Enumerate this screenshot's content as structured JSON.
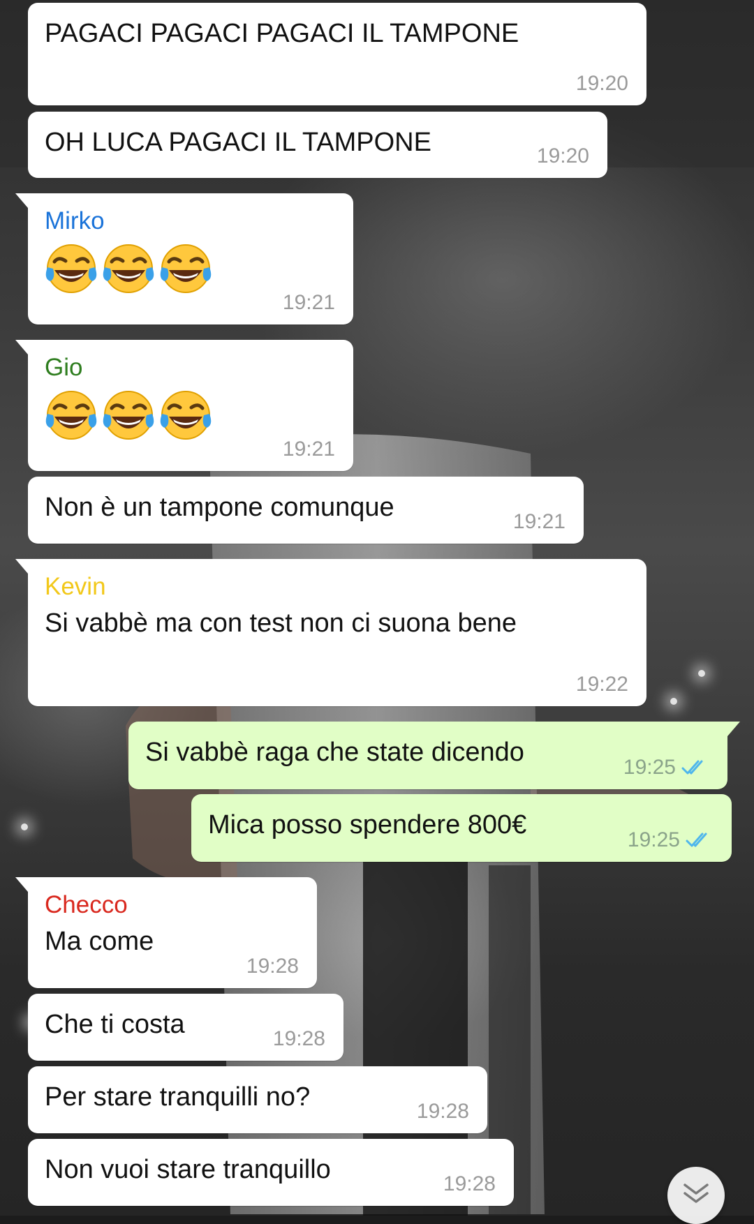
{
  "theme": {
    "outgoing_bubble_color": "#e1fec6",
    "incoming_bubble_color": "#ffffff",
    "read_check_color": "#4fb6ec"
  },
  "messages": [
    {
      "text": "PAGACI PAGACI PAGACI IL TAMPONE",
      "time": "19:20"
    },
    {
      "text": "OH LUCA PAGACI IL TAMPONE",
      "time": "19:20"
    },
    {
      "sender": "Mirko",
      "sender_color": "#1a73d9",
      "emoji": "face-with-tears-of-joy-x3",
      "time": "19:21"
    },
    {
      "sender": "Gio",
      "sender_color": "#2e7d1e",
      "emoji": "face-with-tears-of-joy-x3",
      "time": "19:21"
    },
    {
      "text": "Non è un tampone comunque",
      "time": "19:21"
    },
    {
      "sender": "Kevin",
      "sender_color": "#f2c81a",
      "text": "Si vabbè ma con test non ci suona bene",
      "time": "19:22"
    },
    {
      "text": "Si vabbè raga che state dicendo",
      "time": "19:25",
      "outgoing": true,
      "status": "read"
    },
    {
      "text": "Mica posso spendere 800€",
      "time": "19:25",
      "outgoing": true,
      "status": "read"
    },
    {
      "sender": "Checco",
      "sender_color": "#d9281e",
      "text": "Ma come",
      "time": "19:28"
    },
    {
      "text": "Che ti costa",
      "time": "19:28"
    },
    {
      "text": "Per stare tranquilli no?",
      "time": "19:28"
    },
    {
      "text": "Non vuoi stare tranquillo",
      "time": "19:28"
    }
  ],
  "scroll_button": {
    "icon": "double-chevron-down-icon"
  }
}
